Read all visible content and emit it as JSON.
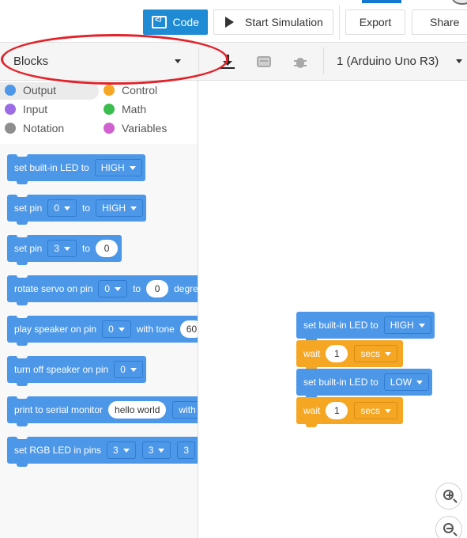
{
  "toolbar": {
    "code_label": "Code",
    "simulation_label": "Start Simulation",
    "export_label": "Export",
    "share_label": "Share"
  },
  "editor": {
    "mode": "Blocks",
    "board": "1 (Arduino Uno R3)",
    "icons": [
      "download-icon",
      "component-icon",
      "debugger-bug-icon"
    ]
  },
  "categories": [
    {
      "name": "Output",
      "color": "#4c97e8"
    },
    {
      "name": "Control",
      "color": "#f5a623"
    },
    {
      "name": "Input",
      "color": "#9b6ce6"
    },
    {
      "name": "Math",
      "color": "#3cbd4f"
    },
    {
      "name": "Notation",
      "color": "#8e8e8e"
    },
    {
      "name": "Variables",
      "color": "#d05fd0"
    }
  ],
  "palette_blocks": {
    "b1": {
      "text": "set built-in LED to",
      "dropdown": "HIGH"
    },
    "b2": {
      "text": "set pin",
      "dropdown": "0",
      "to": "to",
      "dropdown2": "HIGH"
    },
    "b3": {
      "text": "set pin",
      "dropdown": "3",
      "to": "to",
      "value": "0"
    },
    "b4": {
      "text": "rotate servo on pin",
      "dropdown": "0",
      "to": "to",
      "value": "0",
      "suffix": "degre"
    },
    "b5": {
      "text": "play speaker on pin",
      "dropdown": "0",
      "with": "with tone",
      "value": "60"
    },
    "b6": {
      "text": "turn off speaker on pin",
      "dropdown": "0"
    },
    "b7": {
      "text": "print to serial monitor",
      "value": "hello world",
      "suffix": "with"
    },
    "b8": {
      "text": "set RGB LED in pins",
      "d1": "3",
      "d2": "3",
      "d3": "3"
    }
  },
  "script": {
    "s1": {
      "text": "set built-in LED to",
      "dropdown": "HIGH"
    },
    "s2": {
      "text": "wait",
      "value": "1",
      "unit": "secs"
    },
    "s3": {
      "text": "set built-in LED to",
      "dropdown": "LOW"
    },
    "s4": {
      "text": "wait",
      "value": "1",
      "unit": "secs"
    }
  },
  "colors": {
    "output_blue": "#4c97e8",
    "control_orange": "#f5a623",
    "code_button": "#1e8bd4",
    "annotation_red": "#e3222a"
  }
}
